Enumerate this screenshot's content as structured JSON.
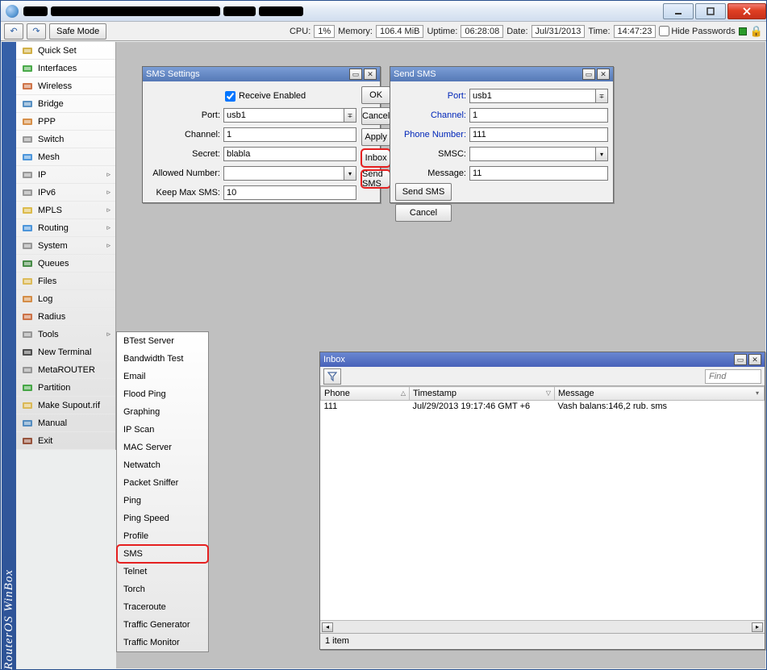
{
  "window": {
    "app_name": "RouterOS WinBox"
  },
  "toolbar": {
    "safe_mode": "Safe Mode",
    "cpu_label": "CPU:",
    "cpu_value": "1%",
    "memory_label": "Memory:",
    "memory_value": "106.4 MiB",
    "uptime_label": "Uptime:",
    "uptime_value": "06:28:08",
    "date_label": "Date:",
    "date_value": "Jul/31/2013",
    "time_label": "Time:",
    "time_value": "14:47:23",
    "hide_passwords": "Hide Passwords"
  },
  "sidebar": {
    "items": [
      {
        "label": "Quick Set",
        "icon": "quickset",
        "arrow": false
      },
      {
        "label": "Interfaces",
        "icon": "interfaces",
        "arrow": false
      },
      {
        "label": "Wireless",
        "icon": "wireless",
        "arrow": false
      },
      {
        "label": "Bridge",
        "icon": "bridge",
        "arrow": false
      },
      {
        "label": "PPP",
        "icon": "ppp",
        "arrow": false
      },
      {
        "label": "Switch",
        "icon": "switch",
        "arrow": false
      },
      {
        "label": "Mesh",
        "icon": "mesh",
        "arrow": false
      },
      {
        "label": "IP",
        "icon": "ip",
        "arrow": true
      },
      {
        "label": "IPv6",
        "icon": "ipv6",
        "arrow": true
      },
      {
        "label": "MPLS",
        "icon": "mpls",
        "arrow": true
      },
      {
        "label": "Routing",
        "icon": "routing",
        "arrow": true
      },
      {
        "label": "System",
        "icon": "system",
        "arrow": true
      },
      {
        "label": "Queues",
        "icon": "queues",
        "arrow": false
      },
      {
        "label": "Files",
        "icon": "files",
        "arrow": false
      },
      {
        "label": "Log",
        "icon": "log",
        "arrow": false
      },
      {
        "label": "Radius",
        "icon": "radius",
        "arrow": false
      },
      {
        "label": "Tools",
        "icon": "tools",
        "arrow": true
      },
      {
        "label": "New Terminal",
        "icon": "terminal",
        "arrow": false
      },
      {
        "label": "MetaROUTER",
        "icon": "metarouter",
        "arrow": false
      },
      {
        "label": "Partition",
        "icon": "partition",
        "arrow": false
      },
      {
        "label": "Make Supout.rif",
        "icon": "supout",
        "arrow": false
      },
      {
        "label": "Manual",
        "icon": "manual",
        "arrow": false
      },
      {
        "label": "Exit",
        "icon": "exit",
        "arrow": false
      }
    ]
  },
  "submenu": {
    "items": [
      "BTest Server",
      "Bandwidth Test",
      "Email",
      "Flood Ping",
      "Graphing",
      "IP Scan",
      "MAC Server",
      "Netwatch",
      "Packet Sniffer",
      "Ping",
      "Ping Speed",
      "Profile",
      "SMS",
      "Telnet",
      "Torch",
      "Traceroute",
      "Traffic Generator",
      "Traffic Monitor"
    ],
    "highlighted_index": 12
  },
  "sms_settings": {
    "title": "SMS Settings",
    "receive_enabled_label": "Receive Enabled",
    "receive_enabled": true,
    "port_label": "Port:",
    "port_value": "usb1",
    "channel_label": "Channel:",
    "channel_value": "1",
    "secret_label": "Secret:",
    "secret_value": "blabla",
    "allowed_label": "Allowed Number:",
    "allowed_value": "",
    "keepmax_label": "Keep Max SMS:",
    "keepmax_value": "10",
    "buttons": {
      "ok": "OK",
      "cancel": "Cancel",
      "apply": "Apply",
      "inbox": "Inbox",
      "sendsms": "Send SMS"
    }
  },
  "send_sms": {
    "title": "Send SMS",
    "port_label": "Port:",
    "port_value": "usb1",
    "channel_label": "Channel:",
    "channel_value": "1",
    "phone_label": "Phone Number:",
    "phone_value": "111",
    "smsc_label": "SMSC:",
    "smsc_value": "",
    "message_label": "Message:",
    "message_value": "11",
    "buttons": {
      "send": "Send SMS",
      "cancel": "Cancel"
    }
  },
  "inbox": {
    "title": "Inbox",
    "find_placeholder": "Find",
    "columns": {
      "phone": "Phone",
      "timestamp": "Timestamp",
      "message": "Message"
    },
    "rows": [
      {
        "phone": "111",
        "timestamp": "Jul/29/2013 19:17:46 GMT +6",
        "message": "Vash balans:146,2 rub.  sms"
      }
    ],
    "status": "1 item"
  },
  "icon_colors": {
    "quickset": "#c9a227",
    "interfaces": "#2a9b2a",
    "wireless": "#c75d2a",
    "bridge": "#3b7db9",
    "ppp": "#d07c2a",
    "switch": "#888",
    "mesh": "#2f85d6",
    "ip": "#888",
    "ipv6": "#888",
    "mpls": "#d8b22f",
    "routing": "#2f85d6",
    "system": "#888",
    "queues": "#2a7a2a",
    "files": "#d8b23f",
    "log": "#d07c2a",
    "radius": "#c75d2a",
    "tools": "#888",
    "terminal": "#333",
    "metarouter": "#888",
    "partition": "#2a9b2a",
    "supout": "#d8b23f",
    "manual": "#3b7db9",
    "exit": "#8a3a1f"
  }
}
